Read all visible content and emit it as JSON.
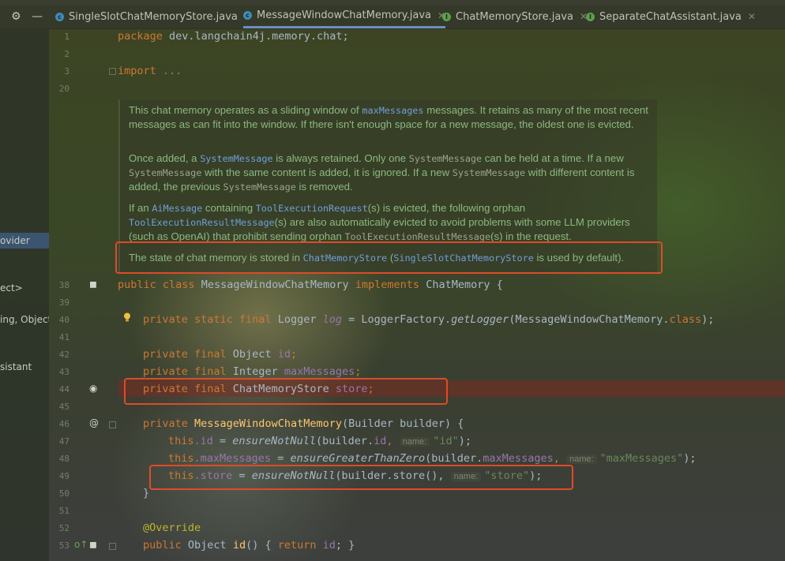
{
  "tabs": [
    {
      "label": "SingleSlotChatMemoryStore.java",
      "kind": "class",
      "active": false
    },
    {
      "label": "MessageWindowChatMemory.java",
      "kind": "class",
      "active": true
    },
    {
      "label": "ChatMemoryStore.java",
      "kind": "interface",
      "active": false
    },
    {
      "label": "SeparateChatAssistant.java",
      "kind": "interface",
      "active": false
    }
  ],
  "toolbar": {
    "settings_icon": "gear-icon",
    "minimize_icon": "minus-icon"
  },
  "left_panel": {
    "items": [
      "ovider",
      "ect>",
      "ing, Object",
      "sistant"
    ],
    "selected_index": 0
  },
  "line_numbers": [
    "1",
    "2",
    "3",
    "20",
    "38",
    "39",
    "40",
    "41",
    "42",
    "43",
    "44",
    "45",
    "46",
    "47",
    "48",
    "49",
    "50",
    "51",
    "52",
    "53"
  ],
  "code": {
    "package": {
      "kw": "package",
      "rest": " dev.langchain4j.memory.chat;"
    },
    "import": {
      "kw": "import",
      "rest": " ..."
    },
    "class_decl": {
      "kw1": "public",
      "kw2": "class",
      "name": "MessageWindowChatMemory",
      "kw3": "implements",
      "iface": "ChatMemory",
      "brace": " {"
    },
    "logger": {
      "kw": "private static final",
      "type": " Logger ",
      "field": "log",
      "eq": " = LoggerFactory.",
      "method": "getLogger",
      "args": "(MessageWindowChatMemory.",
      "cls_kw": "class",
      "end": ");"
    },
    "id_field": {
      "kw": "private final",
      "type": " Object ",
      "field": "id",
      "end": ";"
    },
    "max_field": {
      "kw": "private final",
      "type": " Integer ",
      "field": "maxMessages",
      "end": ";"
    },
    "store_field": {
      "kw": "private final",
      "type": " ChatMemoryStore ",
      "field": "store",
      "end": ";"
    },
    "ctor": {
      "kw": "private",
      "name": " MessageWindowChatMemory",
      "params": "(Builder builder) {"
    },
    "assign_id": {
      "this": "this",
      "field": ".id",
      "eq": " = ",
      "method": "ensureNotNull",
      "args": "(builder.",
      "arg_field": "id",
      "comma": ", ",
      "hint": "name:",
      "str": "\"id\"",
      "end": ");"
    },
    "assign_max": {
      "this": "this",
      "field": ".maxMessages",
      "eq": " = ",
      "method": "ensureGreaterThanZero",
      "args": "(builder.",
      "arg_field": "maxMessages",
      "comma": ", ",
      "hint": "name:",
      "str": "\"maxMessages\"",
      "end": ");"
    },
    "assign_store": {
      "this": "this",
      "field": ".store",
      "eq": " = ",
      "method": "ensureNotNull",
      "args": "(builder.store(),",
      "comma": " ",
      "hint": "name:",
      "str": "\"store\"",
      "end": ");"
    },
    "close_brace": "}",
    "override": "@Override",
    "id_method": {
      "kw": "public",
      "type": " Object ",
      "name": "id",
      "body_open": "() { ",
      "ret": "return",
      "field": " id",
      "body_close": "; }"
    }
  },
  "javadoc": {
    "p1": {
      "t1": "This chat memory operates as a sliding window of ",
      "c1": "maxMessages",
      "t2": " messages. It retains as many of the most recent messages as can fit into the window. If there isn't enough space for a new message, the oldest one is evicted."
    },
    "p2": {
      "t1": "Once added, a ",
      "c1": "SystemMessage",
      "t2": " is always retained. Only one ",
      "c2": "SystemMessage",
      "t3": " can be held at a time. If a new ",
      "c3": "SystemMessage",
      "t4": " with the same content is added, it is ignored. If a new ",
      "c4": "SystemMessage",
      "t5": " with different content is added, the previous ",
      "c5": "SystemMessage",
      "t6": " is removed."
    },
    "p3": {
      "t1": "If an ",
      "c1": "AiMessage",
      "t2": " containing ",
      "c2": "ToolExecutionRequest",
      "t3": "(s) is evicted, the following orphan ",
      "c3": "ToolExecutionResultMessage",
      "t4": "(s) are also automatically evicted to avoid problems with some LLM providers (such as OpenAI) that prohibit sending orphan ",
      "c4": "ToolExecutionResultMessage",
      "t5": "(s) in the request."
    },
    "p4": {
      "t1": "The state of chat memory is stored in ",
      "c1": "ChatMemoryStore",
      "t2": " (",
      "c2": "SingleSlotChatMemoryStore",
      "t3": " is used by default)."
    }
  },
  "colors": {
    "highlight_box": "#e04a28",
    "keyword": "#cc7832",
    "field": "#9876aa",
    "string": "#6a8759",
    "doc_text": "#8cb880",
    "doc_code": "#6f9fd8"
  }
}
